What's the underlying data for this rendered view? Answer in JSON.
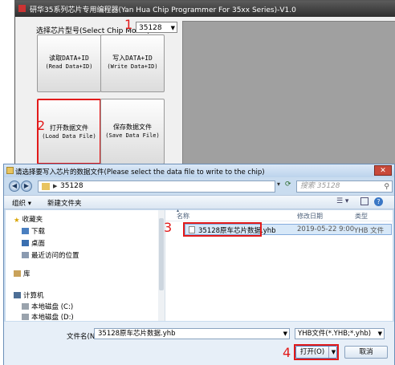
{
  "app": {
    "title": "研华35系列芯片专用编程器(Yan Hua Chip Programmer For 35xx Series)-V1.0",
    "chip_label": "选择芯片型号(Select Chip Model):",
    "chip_value": "35128",
    "buttons": {
      "read_cn": "读取DATA+ID",
      "read_en": "(Read Data+ID)",
      "write_cn": "写入DATA+ID",
      "write_en": "(Write Data+ID)",
      "open_cn": "打开数据文件",
      "open_en": "(Load Data File)",
      "save_cn": "保存数据文件",
      "save_en": "(Save Data File)"
    }
  },
  "annotations": [
    "1",
    "2",
    "3",
    "4"
  ],
  "accent_color": "#e21a1a",
  "dialog": {
    "title": "请选择要写入芯片的数据文件(Please select the data file to write to the chip)",
    "address": "35128",
    "search_placeholder": "搜索 35128",
    "toolbar": {
      "organize": "组织 ▾",
      "new_folder": "新建文件夹"
    },
    "nav": {
      "favorites": "收藏夹",
      "downloads": "下载",
      "desktop": "桌面",
      "recent": "最近访问的位置",
      "libraries": "库",
      "computer": "计算机",
      "disk_c": "本地磁盘 (C:)",
      "disk_d": "本地磁盘 (D:)"
    },
    "columns": {
      "name": "名称",
      "date": "修改日期",
      "type": "类型"
    },
    "files": [
      {
        "name": "35128原车芯片数据.yhb",
        "date": "2019-05-22 9:00",
        "type": "YHB 文件"
      }
    ],
    "filename_label": "文件名(N):",
    "filename_value": "35128原车芯片数据.yhb",
    "filetype_value": "YHB文件(*.YHB;*.yhb)",
    "open_label": "打开(O)",
    "cancel_label": "取消"
  },
  "icons": [
    "back-icon",
    "forward-icon",
    "folder-icon",
    "refresh-icon",
    "search-icon",
    "star-icon",
    "drive-icon",
    "computer-icon",
    "file-icon",
    "help-icon",
    "close-icon"
  ]
}
